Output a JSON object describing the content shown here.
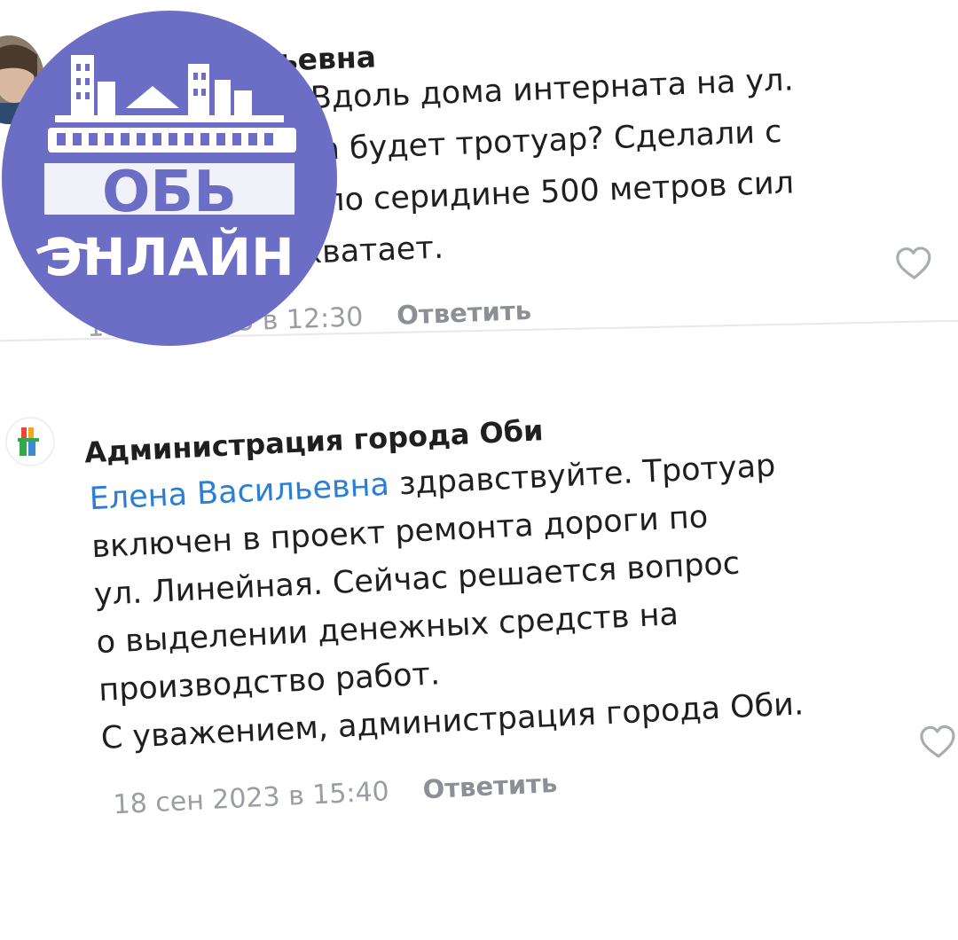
{
  "watermark": {
    "line1": "ОБЬ",
    "line2": "ЭНЛАЙН",
    "color": "#6b6ec4"
  },
  "comments": [
    {
      "author": "Елена Васильевна",
      "text": "Добрый день! Вдоль дома интерната на ул.\nЛинейная когда будет тротуар? Сделали с\nдвух сторон, а по серидине 500 метров сил\nили денег не хватает.",
      "date": "18 сен 2023 в 12:30",
      "reply_label": "Ответить",
      "like_icon": "heart-outline-icon"
    },
    {
      "author": "Администрация города Оби",
      "mention": "Елена Васильевна",
      "text": " здравствуйте. Тротуар\nвключен в проект ремонта дороги по\nул. Линейная. Сейчас решается вопрос\nо выделении денежных средств на\nпроизводство работ.\nС уважением, администрация города Оби.",
      "date": "18 сен 2023 в 15:40",
      "reply_label": "Ответить",
      "like_icon": "heart-outline-icon"
    }
  ],
  "colors": {
    "mention": "#2a7fd4",
    "meta": "#9a9ea4",
    "divider": "#e8e8e8"
  }
}
